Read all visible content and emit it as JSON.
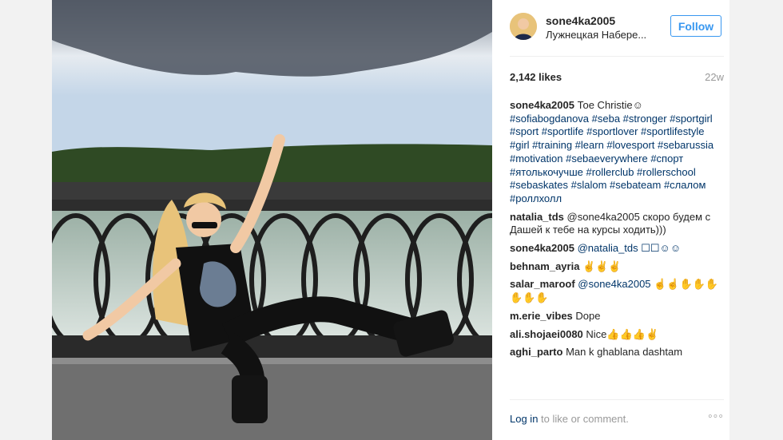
{
  "post": {
    "username": "sone4ka2005",
    "location": "Лужнецкая Набере...",
    "follow_label": "Follow",
    "likes": "2,142 likes",
    "age": "22w"
  },
  "comments": [
    {
      "author": "sone4ka2005",
      "text": " Тое Christie☺",
      "tags": "#sofiabogdanova #seba #stronger #sportgirl #sport #sportlife #sportlover #sportlifestyle #girl #training #learn #lovesport #sebarussia #motivation #sebaeverywhere #спорт #ятолькочучше #rollerclub #rollerschool #sebaskates #slalom #sebateam #слалом #роллхолл"
    },
    {
      "author": "natalia_tds",
      "text": " @sone4ka2005 скоро будем с Дашей к тебе на курсы ходить)))",
      "tags": ""
    },
    {
      "author": "sone4ka2005",
      "text": " @natalia_tds ☐☐☺☺",
      "tags": ""
    },
    {
      "author": "behnam_ayria",
      "text": " ✌✌✌",
      "tags": ""
    },
    {
      "author": "salar_maroof",
      "text": " @sone4ka2005 ☝☝✋✋✋✋✋✋",
      "tags": ""
    },
    {
      "author": "m.erie_vibes",
      "text": " Dope",
      "tags": ""
    },
    {
      "author": "ali.shojaei0080",
      "text": " Nice👍👍👍✌",
      "tags": ""
    },
    {
      "author": "aghi_parto",
      "text": " Man k ghablana dashtam",
      "tags": ""
    }
  ],
  "footer": {
    "login_link": "Log in",
    "login_text": " to like or comment.",
    "more": "◦◦◦"
  }
}
